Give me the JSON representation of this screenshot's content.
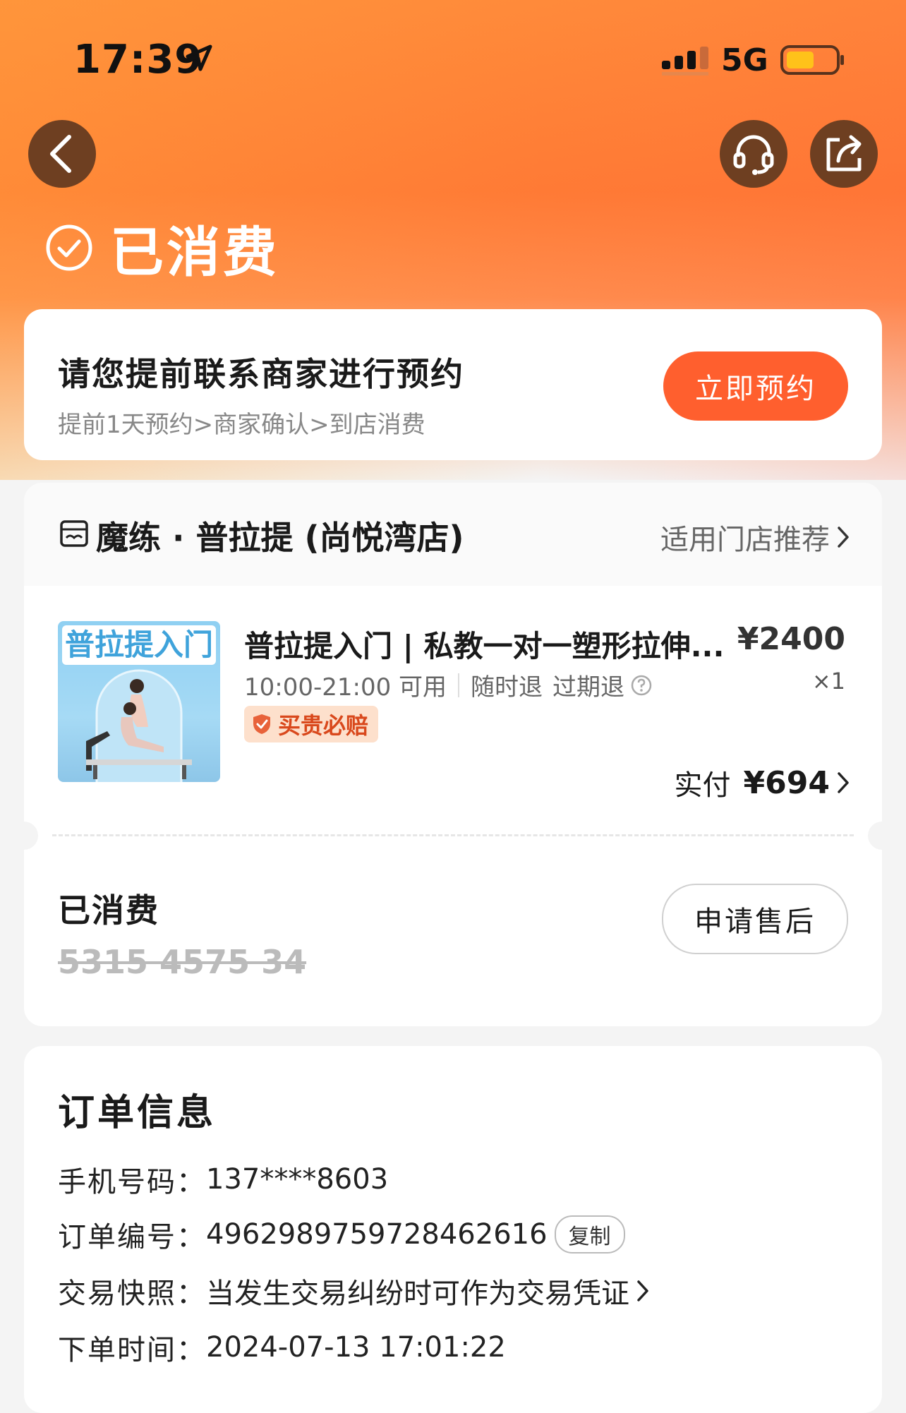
{
  "status_bar": {
    "time": "17:39",
    "network": "5G",
    "location_icon": "location-arrow-icon",
    "signal_icon": "signal-icon",
    "battery_icon": "battery-icon",
    "battery_color": "#ffc21a"
  },
  "header": {
    "back_icon": "back-icon",
    "service_icon": "headset-icon",
    "share_icon": "share-icon",
    "status_icon": "check-circle-icon",
    "status_title": "已消费"
  },
  "booking": {
    "title": "请您提前联系商家进行预约",
    "steps": "提前1天预约>商家确认>到店消费",
    "button_label": "立即预约"
  },
  "store": {
    "icon": "store-icon",
    "name": "魔练 · 普拉提 (尚悦湾店)",
    "link_label": "适用门店推荐"
  },
  "product": {
    "image_banner": "普拉提入门",
    "title": "普拉提入门 | 私教一对一塑形拉伸...",
    "price": "¥2400",
    "hours": "10:00-21:00 可用",
    "refund_anytime": "随时退",
    "refund_expired": "过期退",
    "quantity": "×1",
    "guarantee_label": "买贵必赔",
    "paid_label": "实付",
    "paid_amount": "¥694"
  },
  "voucher": {
    "status": "已消费",
    "code": "5315 4575 34",
    "aftersale_label": "申请售后"
  },
  "order_info": {
    "title": "订单信息",
    "phone_label": "手机号码：",
    "phone_value": "137****8603",
    "order_no_label": "订单编号：",
    "order_no_value": "4962989759728462616",
    "copy_label": "复制",
    "snapshot_label": "交易快照：",
    "snapshot_value": "当发生交易纠纷时可作为交易凭证",
    "order_time_label": "下单时间：",
    "order_time_value": "2024-07-13 17:01:22"
  },
  "colors": {
    "brand_orange": "#ff5f2e",
    "header_orange": "#ff7a35",
    "button_dark": "#6e3f21",
    "tag_red": "#d9481c"
  }
}
